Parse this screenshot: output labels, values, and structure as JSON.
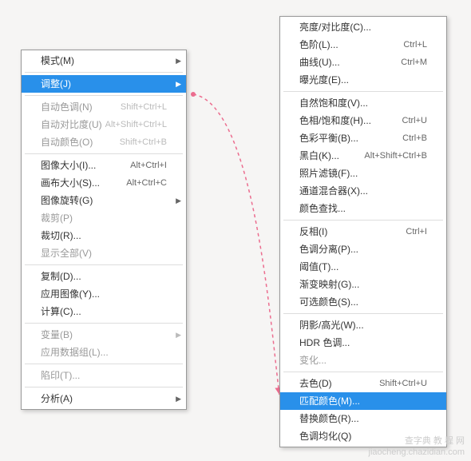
{
  "left_menu": {
    "groups": [
      [
        {
          "label": "模式(M)",
          "shortcut": "",
          "arrow": true,
          "disabled": false,
          "selected": false,
          "name": "menu-mode"
        }
      ],
      [
        {
          "label": "调整(J)",
          "shortcut": "",
          "arrow": true,
          "disabled": false,
          "selected": true,
          "name": "menu-adjust"
        }
      ],
      [
        {
          "label": "自动色调(N)",
          "shortcut": "Shift+Ctrl+L",
          "arrow": false,
          "disabled": true,
          "name": "menu-auto-tone"
        },
        {
          "label": "自动对比度(U)",
          "shortcut": "Alt+Shift+Ctrl+L",
          "arrow": false,
          "disabled": true,
          "name": "menu-auto-contrast"
        },
        {
          "label": "自动颜色(O)",
          "shortcut": "Shift+Ctrl+B",
          "arrow": false,
          "disabled": true,
          "name": "menu-auto-color"
        }
      ],
      [
        {
          "label": "图像大小(I)...",
          "shortcut": "Alt+Ctrl+I",
          "arrow": false,
          "name": "menu-image-size"
        },
        {
          "label": "画布大小(S)...",
          "shortcut": "Alt+Ctrl+C",
          "arrow": false,
          "name": "menu-canvas-size"
        },
        {
          "label": "图像旋转(G)",
          "shortcut": "",
          "arrow": true,
          "name": "menu-image-rotation"
        },
        {
          "label": "裁剪(P)",
          "shortcut": "",
          "arrow": false,
          "disabled": true,
          "name": "menu-crop"
        },
        {
          "label": "裁切(R)...",
          "shortcut": "",
          "arrow": false,
          "name": "menu-trim"
        },
        {
          "label": "显示全部(V)",
          "shortcut": "",
          "arrow": false,
          "disabled": true,
          "name": "menu-reveal-all"
        }
      ],
      [
        {
          "label": "复制(D)...",
          "shortcut": "",
          "arrow": false,
          "name": "menu-duplicate"
        },
        {
          "label": "应用图像(Y)...",
          "shortcut": "",
          "arrow": false,
          "name": "menu-apply-image"
        },
        {
          "label": "计算(C)...",
          "shortcut": "",
          "arrow": false,
          "name": "menu-calculations"
        }
      ],
      [
        {
          "label": "变量(B)",
          "shortcut": "",
          "arrow": true,
          "disabled": true,
          "name": "menu-variables"
        },
        {
          "label": "应用数据组(L)...",
          "shortcut": "",
          "arrow": false,
          "disabled": true,
          "name": "menu-apply-data-set"
        }
      ],
      [
        {
          "label": "陷印(T)...",
          "shortcut": "",
          "arrow": false,
          "disabled": true,
          "name": "menu-trap"
        }
      ],
      [
        {
          "label": "分析(A)",
          "shortcut": "",
          "arrow": true,
          "name": "menu-analysis"
        }
      ]
    ]
  },
  "right_menu": {
    "groups": [
      [
        {
          "label": "亮度/对比度(C)...",
          "shortcut": "",
          "name": "menu-brightness-contrast"
        },
        {
          "label": "色阶(L)...",
          "shortcut": "Ctrl+L",
          "name": "menu-levels"
        },
        {
          "label": "曲线(U)...",
          "shortcut": "Ctrl+M",
          "name": "menu-curves"
        },
        {
          "label": "曝光度(E)...",
          "shortcut": "",
          "name": "menu-exposure"
        }
      ],
      [
        {
          "label": "自然饱和度(V)...",
          "shortcut": "",
          "name": "menu-vibrance"
        },
        {
          "label": "色相/饱和度(H)...",
          "shortcut": "Ctrl+U",
          "name": "menu-hue-saturation"
        },
        {
          "label": "色彩平衡(B)...",
          "shortcut": "Ctrl+B",
          "name": "menu-color-balance"
        },
        {
          "label": "黑白(K)...",
          "shortcut": "Alt+Shift+Ctrl+B",
          "name": "menu-black-white"
        },
        {
          "label": "照片滤镜(F)...",
          "shortcut": "",
          "name": "menu-photo-filter"
        },
        {
          "label": "通道混合器(X)...",
          "shortcut": "",
          "name": "menu-channel-mixer"
        },
        {
          "label": "颜色查找...",
          "shortcut": "",
          "name": "menu-color-lookup"
        }
      ],
      [
        {
          "label": "反相(I)",
          "shortcut": "Ctrl+I",
          "name": "menu-invert"
        },
        {
          "label": "色调分离(P)...",
          "shortcut": "",
          "name": "menu-posterize"
        },
        {
          "label": "阈值(T)...",
          "shortcut": "",
          "name": "menu-threshold"
        },
        {
          "label": "渐变映射(G)...",
          "shortcut": "",
          "name": "menu-gradient-map"
        },
        {
          "label": "可选颜色(S)...",
          "shortcut": "",
          "name": "menu-selective-color"
        }
      ],
      [
        {
          "label": "阴影/高光(W)...",
          "shortcut": "",
          "name": "menu-shadows-highlights"
        },
        {
          "label": "HDR 色调...",
          "shortcut": "",
          "name": "menu-hdr-toning"
        },
        {
          "label": "变化...",
          "shortcut": "",
          "disabled": true,
          "name": "menu-variations"
        }
      ],
      [
        {
          "label": "去色(D)",
          "shortcut": "Shift+Ctrl+U",
          "name": "menu-desaturate"
        },
        {
          "label": "匹配颜色(M)...",
          "shortcut": "",
          "selected": true,
          "name": "menu-match-color"
        },
        {
          "label": "替换颜色(R)...",
          "shortcut": "",
          "name": "menu-replace-color"
        },
        {
          "label": "色调均化(Q)",
          "shortcut": "",
          "name": "menu-equalize"
        }
      ]
    ]
  },
  "watermark": {
    "line1": "查字典  教 程 网",
    "line2": "jiaocheng.chazidian.com"
  }
}
